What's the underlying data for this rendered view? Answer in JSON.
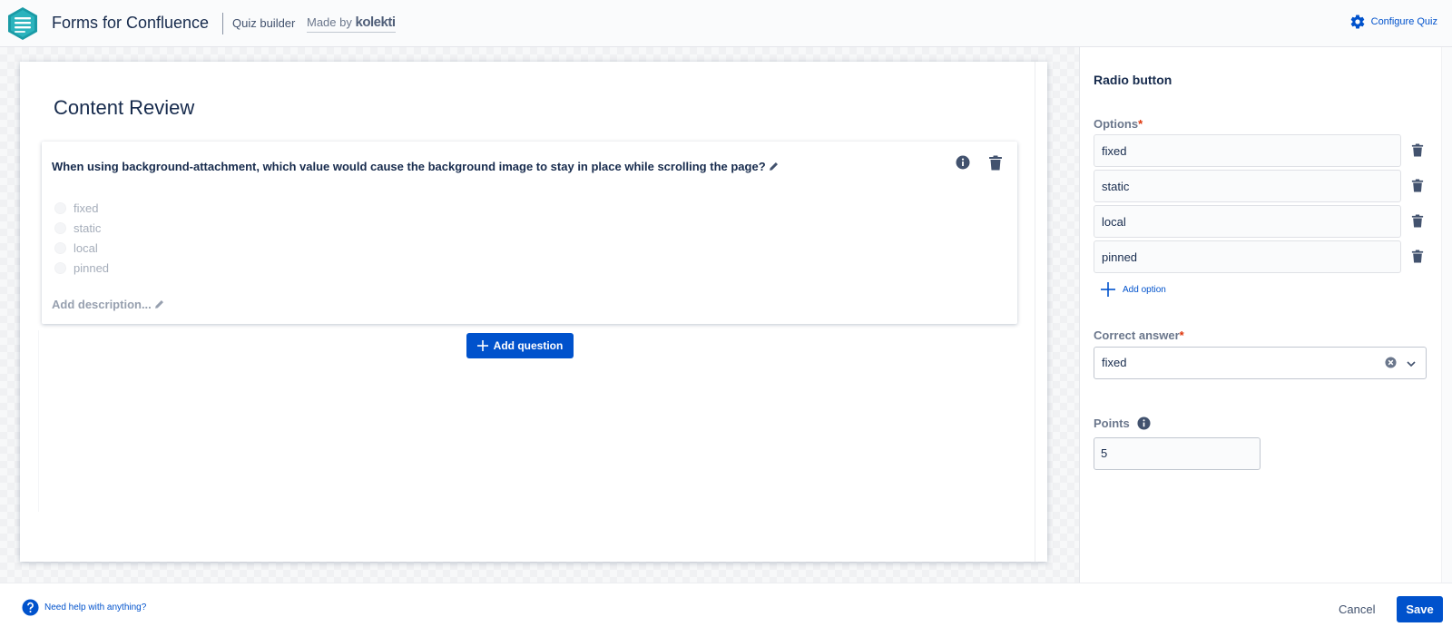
{
  "header": {
    "app_title": "Forms for Confluence",
    "mode": "Quiz builder",
    "made_by_prefix": "Made by",
    "made_by_brand": "kolekti",
    "configure_label": "Configure Quiz",
    "logo_icon": "forms-logo-icon"
  },
  "form": {
    "title": "Content Review",
    "question": {
      "text": "When using background-attachment, which value would cause the background image to stay in place while scrolling the page?",
      "options": [
        "fixed",
        "static",
        "local",
        "pinned"
      ],
      "add_description": "Add description..."
    },
    "add_question_label": "Add question"
  },
  "panel": {
    "title": "Radio button",
    "options_label": "Options",
    "required_mark": "*",
    "options": [
      "fixed",
      "static",
      "local",
      "pinned"
    ],
    "add_option_label": "Add option",
    "correct_answer_label": "Correct answer",
    "correct_answer_value": "fixed",
    "points_label": "Points",
    "points_value": "5"
  },
  "footer": {
    "help_label": "Need help with anything?",
    "cancel_label": "Cancel",
    "save_label": "Save"
  },
  "colors": {
    "accent": "#0052cc",
    "text": "#172b4d",
    "required": "#de350b",
    "logo": "#1a9ba6"
  }
}
